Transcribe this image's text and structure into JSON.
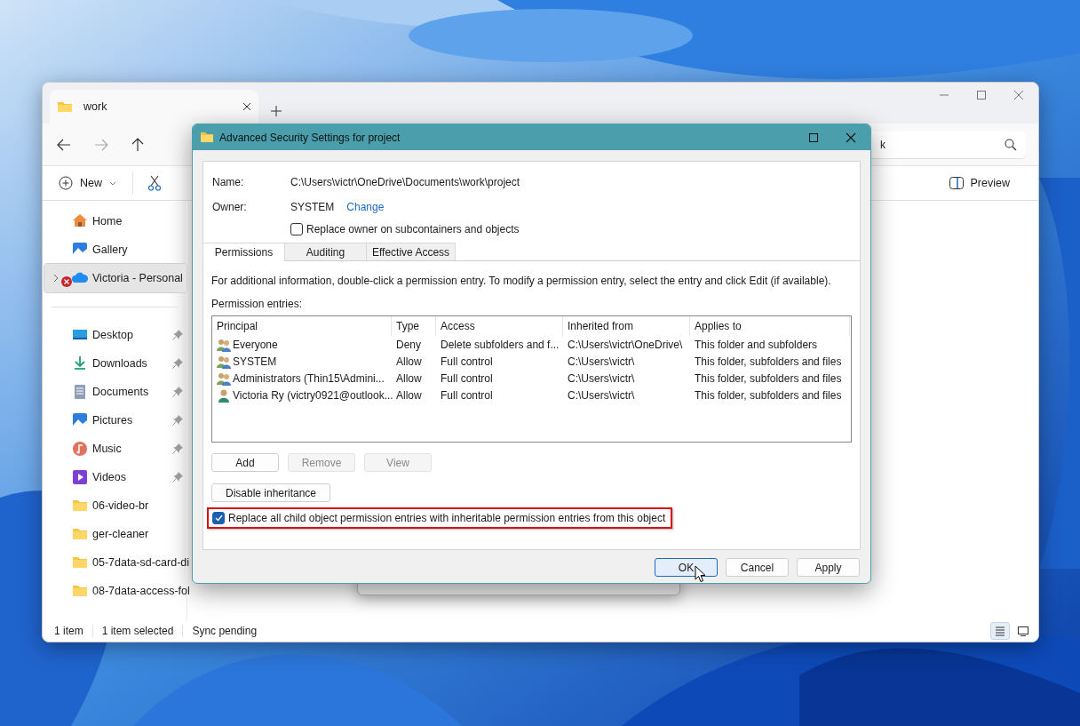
{
  "explorer": {
    "tab": {
      "title": "work"
    },
    "search": {
      "value": "k"
    },
    "toolbar": {
      "new_label": "New",
      "preview_label": "Preview"
    },
    "sidebar": {
      "items": [
        {
          "label": "Home",
          "kind": "home",
          "pinned": false,
          "selected": false,
          "expandable": false,
          "sync_error": false
        },
        {
          "label": "Gallery",
          "kind": "gallery",
          "pinned": false,
          "selected": false,
          "expandable": false,
          "sync_error": false
        },
        {
          "label": "Victoria - Personal",
          "kind": "cloud",
          "pinned": false,
          "selected": true,
          "expandable": true,
          "sync_error": true
        },
        {
          "label": "Desktop",
          "kind": "desktop",
          "pinned": true,
          "selected": false,
          "expandable": false,
          "sync_error": false
        },
        {
          "label": "Downloads",
          "kind": "downloads",
          "pinned": true,
          "selected": false,
          "expandable": false,
          "sync_error": false
        },
        {
          "label": "Documents",
          "kind": "documents",
          "pinned": true,
          "selected": false,
          "expandable": false,
          "sync_error": false
        },
        {
          "label": "Pictures",
          "kind": "pictures",
          "pinned": true,
          "selected": false,
          "expandable": false,
          "sync_error": false
        },
        {
          "label": "Music",
          "kind": "music",
          "pinned": true,
          "selected": false,
          "expandable": false,
          "sync_error": false
        },
        {
          "label": "Videos",
          "kind": "videos",
          "pinned": true,
          "selected": false,
          "expandable": false,
          "sync_error": false
        },
        {
          "label": "06-video-br",
          "kind": "folder",
          "pinned": false,
          "selected": false,
          "expandable": false,
          "sync_error": false
        },
        {
          "label": "ger-cleaner",
          "kind": "folder",
          "pinned": false,
          "selected": false,
          "expandable": false,
          "sync_error": false
        },
        {
          "label": "05-7data-sd-card-di",
          "kind": "folder",
          "pinned": false,
          "selected": false,
          "expandable": false,
          "sync_error": false
        },
        {
          "label": "08-7data-access-fol",
          "kind": "folder",
          "pinned": false,
          "selected": false,
          "expandable": false,
          "sync_error": false
        }
      ]
    },
    "status_bar": {
      "items": [
        "1 item",
        "1 item selected",
        "Sync pending"
      ]
    },
    "view_buttons": [
      {
        "kind": "details",
        "selected": true
      },
      {
        "kind": "tiles",
        "selected": false
      }
    ]
  },
  "dialog": {
    "title": "Advanced Security Settings for project",
    "name_label": "Name:",
    "name_value": "C:\\Users\\victr\\OneDrive\\Documents\\work\\project",
    "owner_label": "Owner:",
    "owner_value": "SYSTEM",
    "change_link": "Change",
    "replace_owner": {
      "label": "Replace owner on subcontainers and objects",
      "checked": false
    },
    "tabs": [
      {
        "label": "Permissions",
        "selected": true
      },
      {
        "label": "Auditing",
        "selected": false
      },
      {
        "label": "Effective Access",
        "selected": false
      }
    ],
    "info": "For additional information, double-click a permission entry. To modify a permission entry, select the entry and click Edit (if available).",
    "entries_label": "Permission entries:",
    "columns": [
      "Principal",
      "Type",
      "Access",
      "Inherited from",
      "Applies to"
    ],
    "rows": [
      {
        "kind": "group",
        "principal": "Everyone",
        "type": "Deny",
        "access": "Delete subfolders and f...",
        "inherited_from": "C:\\Users\\victr\\OneDrive\\",
        "applies_to": "This folder and subfolders"
      },
      {
        "kind": "group",
        "principal": "SYSTEM",
        "type": "Allow",
        "access": "Full control",
        "inherited_from": "C:\\Users\\victr\\",
        "applies_to": "This folder, subfolders and files"
      },
      {
        "kind": "group",
        "principal": "Administrators (Thin15\\Admini...",
        "type": "Allow",
        "access": "Full control",
        "inherited_from": "C:\\Users\\victr\\",
        "applies_to": "This folder, subfolders and files"
      },
      {
        "kind": "user",
        "principal": "Victoria Ry (victry0921@outlook...",
        "type": "Allow",
        "access": "Full control",
        "inherited_from": "C:\\Users\\victr\\",
        "applies_to": "This folder, subfolders and files"
      }
    ],
    "entry_buttons": [
      {
        "label": "Add",
        "disabled": false
      },
      {
        "label": "Remove",
        "disabled": true
      },
      {
        "label": "View",
        "disabled": true
      }
    ],
    "inheritance_button": "Disable inheritance",
    "replace_child": {
      "label": "Replace all child object permission entries with inheritable permission entries from this object",
      "checked": true,
      "highlighted": true
    },
    "footer_buttons": [
      {
        "label": "OK",
        "focused": true
      },
      {
        "label": "Cancel",
        "focused": false
      },
      {
        "label": "Apply",
        "focused": false
      }
    ]
  }
}
